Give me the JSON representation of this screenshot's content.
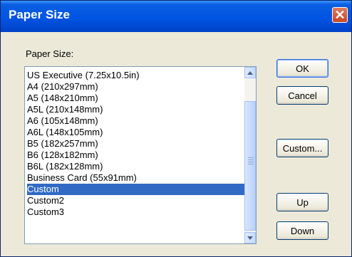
{
  "window": {
    "title": "Paper Size"
  },
  "main": {
    "list_label": "Paper Size:",
    "items": [
      "US Executive (7.25x10.5in)",
      "A4 (210x297mm)",
      "A5 (148x210mm)",
      "A5L (210x148mm)",
      "A6 (105x148mm)",
      "A6L (148x105mm)",
      "B5 (182x257mm)",
      "B6 (128x182mm)",
      "B6L (182x128mm)",
      "Business Card (55x91mm)",
      "Custom",
      "Custom2",
      "Custom3"
    ],
    "selected": "Custom"
  },
  "buttons": {
    "ok": "OK",
    "cancel": "Cancel",
    "custom": "Custom...",
    "up": "Up",
    "down": "Down"
  },
  "icons": {
    "close": "close-icon",
    "scroll_up": "scroll-up-arrow-icon",
    "scroll_down": "scroll-down-arrow-icon"
  }
}
